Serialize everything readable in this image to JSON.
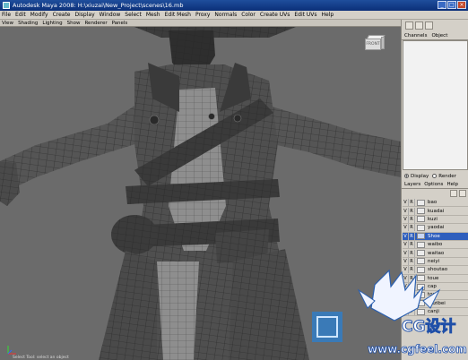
{
  "window": {
    "title": "Autodesk Maya 2008: H:\\xiuzai\\New_Project\\scenes\\16.mb"
  },
  "menubar": [
    "File",
    "Edit",
    "Modify",
    "Create",
    "Display",
    "Window",
    "Select",
    "Mesh",
    "Edit Mesh",
    "Proxy",
    "Normals",
    "Color",
    "Create UVs",
    "Edit UVs",
    "Help"
  ],
  "panel_menu": [
    "View",
    "Shading",
    "Lighting",
    "Show",
    "Renderer",
    "Panels"
  ],
  "viewcube": {
    "label": "FRONT"
  },
  "status": {
    "text": "Select Tool: select an object"
  },
  "channel_box": {
    "tabs": [
      "Channels",
      "Object"
    ]
  },
  "layer_editor": {
    "mode_options": [
      "Display",
      "Render"
    ],
    "selected_mode": "Display",
    "menu": [
      "Layers",
      "Options",
      "Help"
    ],
    "layers": [
      {
        "v": "V",
        "r": "R",
        "name": "bao",
        "selected": false
      },
      {
        "v": "V",
        "r": "R",
        "name": "kuadai",
        "selected": false
      },
      {
        "v": "V",
        "r": "R",
        "name": "kuzi",
        "selected": false
      },
      {
        "v": "V",
        "r": "R",
        "name": "yaodai",
        "selected": false
      },
      {
        "v": "V",
        "r": "R",
        "name": "Shoe",
        "selected": true
      },
      {
        "v": "V",
        "r": "R",
        "name": "waibo",
        "selected": false
      },
      {
        "v": "V",
        "r": "R",
        "name": "waitao",
        "selected": false
      },
      {
        "v": "V",
        "r": "R",
        "name": "neiyi",
        "selected": false
      },
      {
        "v": "V",
        "r": "R",
        "name": "shoutao",
        "selected": false
      },
      {
        "v": "V",
        "r": "R",
        "name": "toue",
        "selected": false
      },
      {
        "v": "V",
        "r": "R",
        "name": "cap",
        "selected": false
      },
      {
        "v": "V",
        "r": "R",
        "name": "tou",
        "selected": false
      },
      {
        "v": "V",
        "r": "R",
        "name": "huzibei",
        "selected": false
      },
      {
        "v": "V",
        "r": "T",
        "name": "canji",
        "selected": false
      }
    ]
  },
  "watermark": {
    "brand": "CG设计",
    "url": "www.cgfeel.com"
  },
  "colors": {
    "titlebar": "#0b2f78",
    "ui_gray": "#d4d0c8",
    "viewport_bg": "#6b6b6b",
    "selection": "#2f5fbd"
  }
}
